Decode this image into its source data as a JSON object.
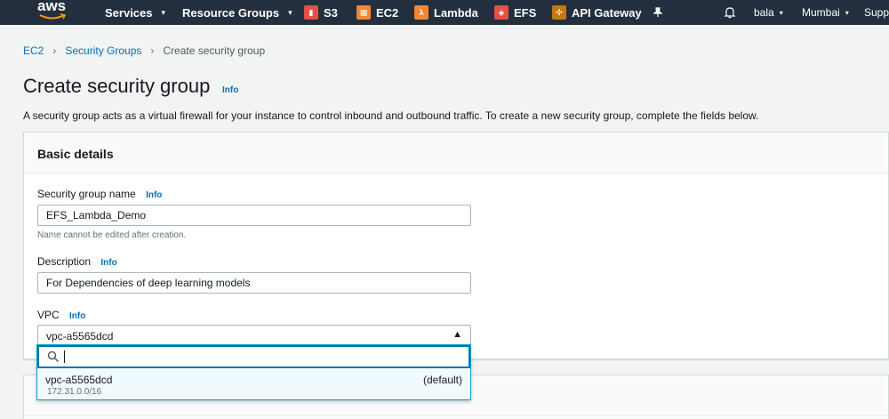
{
  "nav": {
    "logo": "aws",
    "items": [
      {
        "label": "Services",
        "caret": "▾"
      },
      {
        "label": "Resource Groups",
        "caret": "▾"
      }
    ],
    "shortcuts": [
      {
        "label": "S3",
        "icon": "s3-icon",
        "color": "#e05243"
      },
      {
        "label": "EC2",
        "icon": "ec2-icon",
        "color": "#f58536"
      },
      {
        "label": "Lambda",
        "icon": "lambda-icon",
        "color": "#f58536"
      },
      {
        "label": "EFS",
        "icon": "efs-icon",
        "color": "#e05243"
      },
      {
        "label": "API Gateway",
        "icon": "api-gateway-icon",
        "color": "#c17b12"
      }
    ],
    "user": "bala",
    "region": "Mumbai",
    "support": "Support"
  },
  "breadcrumb": [
    "EC2",
    "Security Groups",
    "Create security group"
  ],
  "page": {
    "title": "Create security group",
    "info": "Info",
    "description": "A security group acts as a virtual firewall for your instance to control inbound and outbound traffic. To create a new security group, complete the fields below."
  },
  "basic_details": {
    "header": "Basic details",
    "name_label": "Security group name",
    "name_info": "Info",
    "name_value": "EFS_Lambda_Demo",
    "name_hint": "Name cannot be edited after creation.",
    "desc_label": "Description",
    "desc_info": "Info",
    "desc_value": "For Dependencies of deep learning models",
    "vpc_label": "VPC",
    "vpc_info": "Info",
    "vpc_value": "vpc-a5565dcd"
  },
  "vpc_dropdown": {
    "search_value": "",
    "options": [
      {
        "name": "vpc-a5565dcd",
        "cidr": "172.31.0.0/16",
        "tag": "(default)"
      }
    ]
  },
  "colors": {
    "nav_bg": "#232f3e",
    "link": "#0073bb",
    "focus": "#0073bb"
  }
}
